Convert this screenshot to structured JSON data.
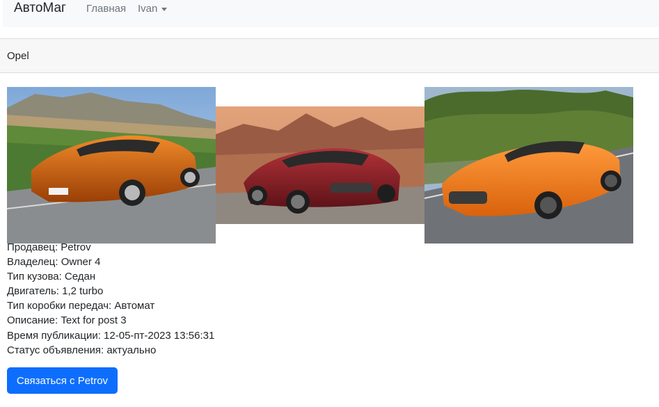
{
  "navbar": {
    "brand": "АвтоМаг",
    "home_label": "Главная",
    "user_label": "Ivan"
  },
  "post": {
    "title": "Opel",
    "photos": [
      {
        "scene": "orange sports car on road, countryside hills"
      },
      {
        "scene": "red sports car, desert mountains at sunset"
      },
      {
        "scene": "orange sports car on road, trees"
      }
    ],
    "details": [
      "Продавец: Petrov",
      "Владелец: Owner 4",
      "Тип кузова: Седан",
      "Двигатель: 1,2 turbo",
      "Тип коробки передач: Автомат",
      "Описание: Text for post 3",
      "Время публикации: 12-05-пт-2023 13:56:31",
      "Статус объявления: актуально"
    ],
    "contact_label": "Связаться с Petrov"
  },
  "colors": {
    "primary": "#0d6efd",
    "navbar_bg": "#f8f9fa",
    "header_bg": "#f7f7f7"
  }
}
